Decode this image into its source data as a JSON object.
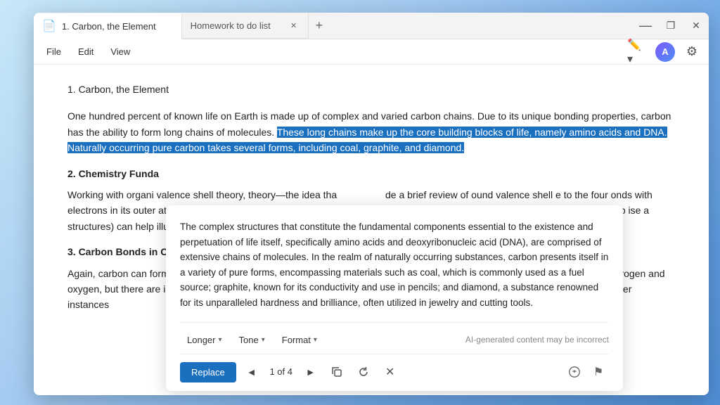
{
  "window": {
    "title": "1. Carbon, the Element"
  },
  "tabs": [
    {
      "id": "tab-1",
      "label": "1. Carbon, the Element",
      "icon": "📄",
      "active": true
    },
    {
      "id": "tab-2",
      "label": "Homework to do list",
      "active": false
    }
  ],
  "tab_add_label": "+",
  "window_controls": {
    "minimize": "—",
    "maximize": "❐",
    "close": "✕"
  },
  "menu": {
    "items": [
      "File",
      "Edit",
      "View"
    ],
    "right_icons": [
      "pen",
      "avatar",
      "settings"
    ]
  },
  "document": {
    "title": "1. Carbon, the Element",
    "paragraph1_before": "One hundred percent of known life on Earth is made up of complex and varied carbon chains. Due to its unique bonding properties, carbon has the ability to form long chains of molecules.",
    "paragraph1_highlight": "These long chains make up the core building blocks of life, namely amino acids and DNA. Naturally occurring pure carbon takes several forms, including coal, graphite, and diamond.",
    "section2_heading": "2. Chemistry Funda",
    "paragraph2": "Working with organi valence shell theory, theory—the idea tha electrons in its outer atoms or molecules. play a pivotal role in structures) can help illuminate the event tell us its basic shap",
    "paragraph2_right": "de a brief review of ound valence shell e to the four onds with other s dot structures ing resonant ibital shells can help ise a molecule can",
    "section3_heading": "3. Carbon Bonds in C",
    "paragraph3": "Again, carbon can form up to four bonds with other molecules. In organic chemistry, we mainly focus on carbon chains with hydrogen and oxygen, but there are infinite possible compounds. In the simplest form, carbon bonds with four hydrogen in single bonds. In other instances"
  },
  "ai_popup": {
    "text": "The complex structures that constitute the fundamental components essential to the existence and perpetuation of life itself, specifically amino acids and deoxyribonucleic acid (DNA), are comprised of extensive chains of molecules. In the realm of naturally occurring substances, carbon presents itself in a variety of pure forms, encompassing materials such as coal, which is commonly used as a fuel source; graphite, known for its conductivity and use in pencils; and diamond, a substance renowned for its unparalleled hardness and brilliance, often utilized in jewelry and cutting tools.",
    "toolbar": {
      "longer_label": "Longer",
      "tone_label": "Tone",
      "format_label": "Format",
      "disclaimer": "AI-generated content may be incorrect"
    },
    "replace_bar": {
      "replace_label": "Replace",
      "prev_icon": "◄",
      "next_icon": "►",
      "count": "1 of 4",
      "copy_icon": "⧉",
      "refresh_icon": "↻",
      "close_icon": "✕",
      "like_icon": "👍",
      "flag_icon": "⚑"
    }
  }
}
